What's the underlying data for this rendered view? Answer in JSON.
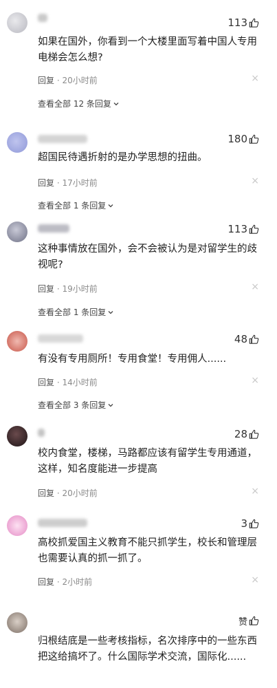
{
  "comments": [
    {
      "likes": "113",
      "text": "如果在国外，你看到一个大楼里面写着中国人专用电梯会怎么想?",
      "reply": "回复",
      "time": "20小时前",
      "more": "查看全部 12 条回复"
    },
    {
      "likes": "180",
      "text": "超国民待遇折射的是办学思想的扭曲。",
      "reply": "回复",
      "time": "17小时前",
      "more": "查看全部 1 条回复"
    },
    {
      "likes": "113",
      "text": "这种事情放在国外，会不会被认为是对留学生的歧视呢?",
      "reply": "回复",
      "time": "19小时前",
      "more": "查看全部 1 条回复"
    },
    {
      "likes": "48",
      "text": "有没有专用厕所！专用食堂！专用佣人......",
      "reply": "回复",
      "time": "14小时前",
      "more": "查看全部 3 条回复"
    },
    {
      "likes": "28",
      "text": "校内食堂，楼梯，马路都应该有留学生专用通道，这样，知名度能进一步提高",
      "reply": "回复",
      "time": "20小时前"
    },
    {
      "likes": "3",
      "text": "高校抓爱国主义教育不能只抓学生，校长和管理层也需要认真的抓一抓了。",
      "reply": "回复",
      "time": "2小时前"
    },
    {
      "likes": "赞",
      "text": "归根结底是一些考核指标，名次排序中的一些东西把这给搞坏了。什么国际学术交流，国际化......"
    }
  ],
  "icons": {
    "like": "thumbs-up-icon",
    "close": "close-icon",
    "expand": "chevron-down-icon"
  },
  "separator": "·",
  "close_glyph": "×"
}
